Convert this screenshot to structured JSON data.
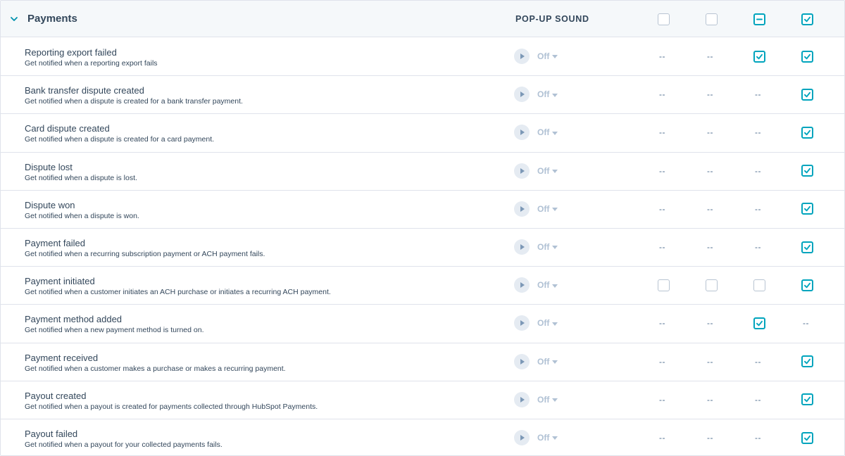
{
  "section": {
    "title": "Payments",
    "column_header": "POP-UP SOUND",
    "header_checkboxes": [
      "empty",
      "empty",
      "indeterminate",
      "checked"
    ]
  },
  "accent_color": "#00a4bd",
  "dash_text": "--",
  "rows": [
    {
      "title": "Reporting export failed",
      "desc": "Get notified when a reporting export fails",
      "sound": "Off",
      "channels": [
        "dash",
        "dash",
        "checked",
        "checked"
      ]
    },
    {
      "title": "Bank transfer dispute created",
      "desc": "Get notified when a dispute is created for a bank transfer payment.",
      "sound": "Off",
      "channels": [
        "dash",
        "dash",
        "dash",
        "checked"
      ]
    },
    {
      "title": "Card dispute created",
      "desc": "Get notified when a dispute is created for a card payment.",
      "sound": "Off",
      "channels": [
        "dash",
        "dash",
        "dash",
        "checked"
      ]
    },
    {
      "title": "Dispute lost",
      "desc": "Get notified when a dispute is lost.",
      "sound": "Off",
      "channels": [
        "dash",
        "dash",
        "dash",
        "checked"
      ]
    },
    {
      "title": "Dispute won",
      "desc": "Get notified when a dispute is won.",
      "sound": "Off",
      "channels": [
        "dash",
        "dash",
        "dash",
        "checked"
      ]
    },
    {
      "title": "Payment failed",
      "desc": "Get notified when a recurring subscription payment or ACH payment fails.",
      "sound": "Off",
      "channels": [
        "dash",
        "dash",
        "dash",
        "checked"
      ]
    },
    {
      "title": "Payment initiated",
      "desc": "Get notified when a customer initiates an ACH purchase or initiates a recurring ACH payment.",
      "sound": "Off",
      "channels": [
        "empty",
        "empty",
        "empty",
        "checked"
      ]
    },
    {
      "title": "Payment method added",
      "desc": "Get notified when a new payment method is turned on.",
      "sound": "Off",
      "channels": [
        "dash",
        "dash",
        "checked",
        "dash"
      ]
    },
    {
      "title": "Payment received",
      "desc": "Get notified when a customer makes a purchase or makes a recurring payment.",
      "sound": "Off",
      "channels": [
        "dash",
        "dash",
        "dash",
        "checked"
      ]
    },
    {
      "title": "Payout created",
      "desc": "Get notified when a payout is created for payments collected through HubSpot Payments.",
      "sound": "Off",
      "channels": [
        "dash",
        "dash",
        "dash",
        "checked"
      ]
    },
    {
      "title": "Payout failed",
      "desc": "Get notified when a payout for your collected payments fails.",
      "sound": "Off",
      "channels": [
        "dash",
        "dash",
        "dash",
        "checked"
      ]
    }
  ]
}
